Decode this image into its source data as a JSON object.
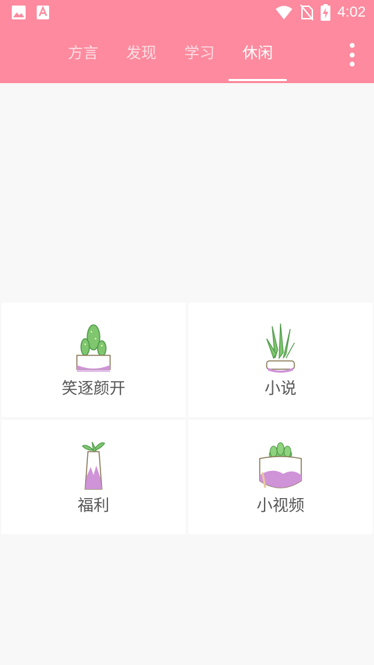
{
  "status_bar": {
    "time": "4:02",
    "icons": [
      "image-icon",
      "text-a-icon",
      "wifi-icon",
      "no-sim-icon",
      "battery-charging-icon"
    ]
  },
  "tabs": [
    {
      "label": "方言",
      "active": false
    },
    {
      "label": "发现",
      "active": false
    },
    {
      "label": "学习",
      "active": false
    },
    {
      "label": "休闲",
      "active": true
    }
  ],
  "grid": [
    {
      "label": "笑逐颜开",
      "icon": "cactus-pot-icon"
    },
    {
      "label": "小说",
      "icon": "aloe-pot-icon"
    },
    {
      "label": "福利",
      "icon": "vase-plant-icon"
    },
    {
      "label": "小视频",
      "icon": "succulent-pot-icon"
    }
  ],
  "colors": {
    "header": "#fd8a9e",
    "background": "#f8f8f8",
    "plant_green": "#7fc66f",
    "pot_purple": "#cf93d8"
  }
}
